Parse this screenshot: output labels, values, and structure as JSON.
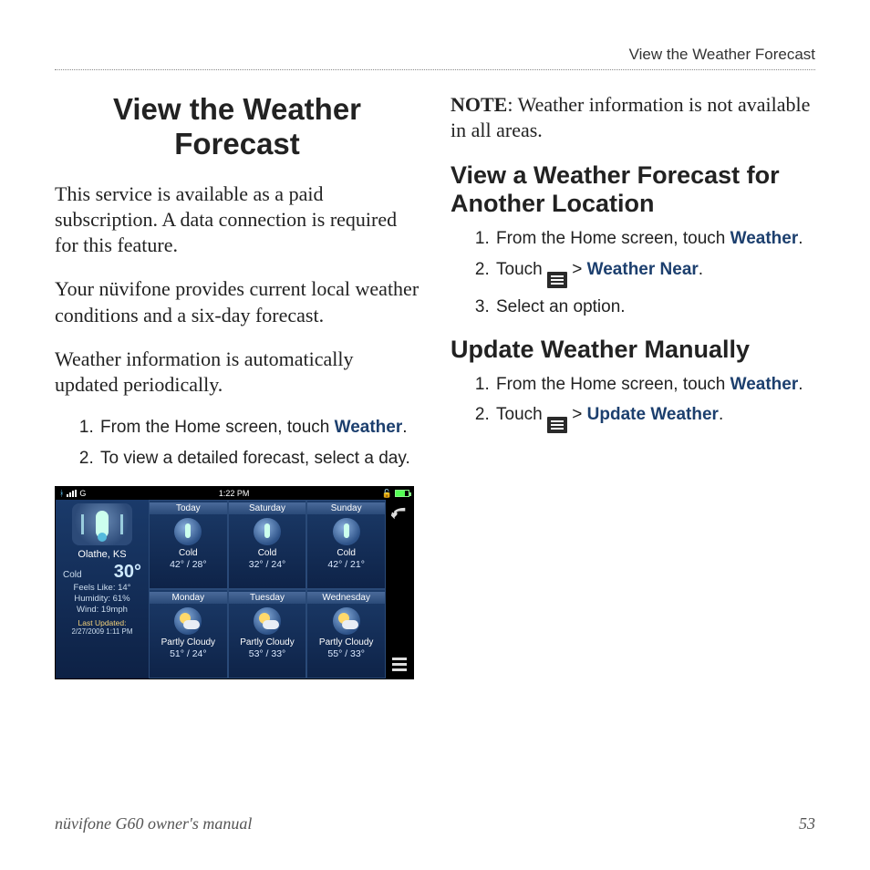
{
  "running_header": "View the Weather Forecast",
  "title": "View the Weather Forecast",
  "intro": {
    "p1": "This service is available as a paid subscription. A data connection is required for this feature.",
    "p2": "Your nüvifone provides current local weather conditions and a six-day forecast.",
    "p3": "Weather information is automatically updated periodically."
  },
  "steps_main": {
    "s1_pre": "From the Home screen, touch ",
    "s1_link": "Weather",
    "s2": "To view a detailed forecast, select a day."
  },
  "note": {
    "label": "NOTE",
    "text": ": Weather information is not available in all areas."
  },
  "section2": {
    "title": "View a Weather Forecast for Another Location",
    "s1_pre": "From the Home screen, touch ",
    "s1_link": "Weather",
    "s2_pre": "Touch ",
    "s2_sep": " > ",
    "s2_link": "Weather Near",
    "s3": "Select an option."
  },
  "section3": {
    "title": "Update Weather Manually",
    "s1_pre": "From the Home screen, touch ",
    "s1_link": "Weather",
    "s2_pre": "Touch ",
    "s2_sep": " > ",
    "s2_link": "Update Weather"
  },
  "footer": {
    "manual": "nüvifone G60 owner's manual",
    "page": "53"
  },
  "device": {
    "status": {
      "carrier": "G",
      "time": "1:22 PM"
    },
    "current": {
      "location": "Olathe, KS",
      "condition": "Cold",
      "temp": "30°",
      "feels": "Feels Like:  14°",
      "humidity": "Humidity:  61%",
      "wind": "Wind:  19mph",
      "updated_label": "Last Updated:",
      "updated_time": "2/27/2009 1:11 PM"
    },
    "days": [
      {
        "name": "Today",
        "cond": "Cold",
        "hi": "42°",
        "lo": "28°",
        "icon": "cold"
      },
      {
        "name": "Saturday",
        "cond": "Cold",
        "hi": "32°",
        "lo": "24°",
        "icon": "cold"
      },
      {
        "name": "Sunday",
        "cond": "Cold",
        "hi": "42°",
        "lo": "21°",
        "icon": "cold"
      },
      {
        "name": "Monday",
        "cond": "Partly Cloudy",
        "hi": "51°",
        "lo": "24°",
        "icon": "pc"
      },
      {
        "name": "Tuesday",
        "cond": "Partly Cloudy",
        "hi": "53°",
        "lo": "33°",
        "icon": "pc"
      },
      {
        "name": "Wednesday",
        "cond": "Partly Cloudy",
        "hi": "55°",
        "lo": "33°",
        "icon": "pc"
      }
    ]
  }
}
